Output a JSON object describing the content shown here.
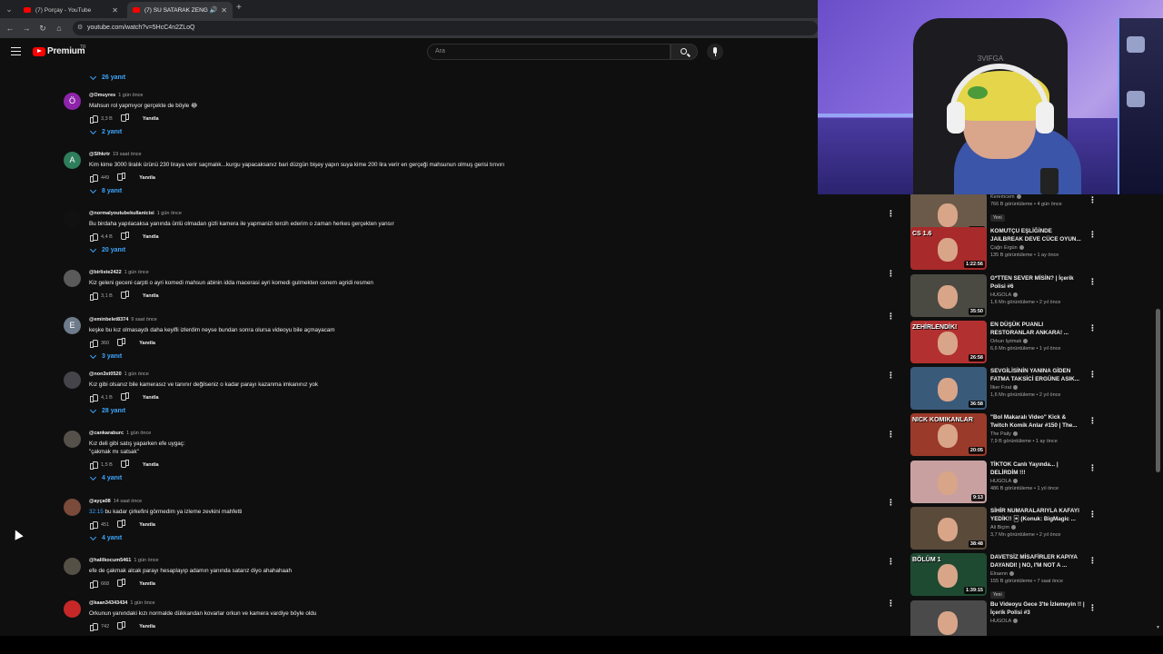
{
  "browser": {
    "tabs": [
      {
        "title": "(7) Porçay - YouTube",
        "active": false
      },
      {
        "title": "(7) SU SATARAK ZENGİN OLMAK",
        "active": true
      }
    ],
    "url": "youtube.com/watch?v=5HcC4n2ZLoQ"
  },
  "masthead": {
    "logo_text": "Premium",
    "country_code": "TR",
    "search_placeholder": "Ara"
  },
  "comments": {
    "top_replies": "26 yanıt",
    "reply_label": "Yanıtla",
    "items": [
      {
        "handle": "@Omuyres",
        "time": "1 gün önce",
        "text": "Mahsun rol yapmıyor gerçekte de böyle 😂",
        "likes": "3,3 B",
        "replies": "2 yanıt",
        "avatar_letter": "Ö",
        "avatar_color": "#8e24aa"
      },
      {
        "handle": "@Slhkrtr",
        "time": "19 saat önce",
        "text": "Kim kime 3000 liralık ürünü 230 liraya verir saçmalık...kurgu yapacaksanız bari düzgün bişey yapın suya kime 200 lira verir en gerçeği mahsunun olmuş gerisi tırıvırı",
        "likes": "449",
        "replies": "8 yanıt",
        "avatar_letter": "A",
        "avatar_color": "#2e7d5b"
      },
      {
        "handle": "@normalyoutubekullanicisi",
        "time": "1 gün önce",
        "text": "Bu birdaha yapılacaksa yanında ünlü olmadan gizli kamera ile yapmanizi tercih ederim o zaman herkes gerçekten yansır",
        "likes": "4,4 B",
        "replies": "20 yanıt",
        "avatar_letter": "",
        "avatar_color": "#111111"
      },
      {
        "handle": "@birliste2422",
        "time": "1 gün önce",
        "text": "Kiz geleni geceni carpti o ayri komedi mahsun abinin idda macerasi ayri komedi gulmekten cenem agridi resmen",
        "likes": "3,1 B",
        "replies": "",
        "avatar_letter": "",
        "avatar_color": "#5a5a5a"
      },
      {
        "handle": "@eminbelet8374",
        "time": "9 saat önce",
        "text": "keşke bu kız olmasaydı daha keyifli izlerdim neyse bundan sonra olursa videoyu bile açmayacam",
        "likes": "360",
        "replies": "3 yanıt",
        "avatar_letter": "E",
        "avatar_color": "#6d7b8a"
      },
      {
        "handle": "@non3xt0520",
        "time": "1 gün önce",
        "text": "Kız gibi olsanız bile kamerasız ve tanınır değilseniz o kadar parayı kazanma imkanınız yok",
        "likes": "4,1 B",
        "replies": "28 yanıt",
        "avatar_letter": "",
        "avatar_color": "#44444a"
      },
      {
        "handle": "@cankaraburc",
        "time": "1 gün önce",
        "text": "Kız deli gibi satış yaparken efe uygaç:\n\"çakmak mı satsak\"",
        "likes": "1,5 B",
        "replies": "4 yanıt",
        "avatar_letter": "",
        "avatar_color": "#55504a"
      },
      {
        "handle": "@ayça08",
        "time": "14 saat önce",
        "timestamp_link": "32:15",
        "text": " bu kadar çirkefini görmedim ya izleme zevkini mahfetti",
        "likes": "451",
        "replies": "4 yanıt",
        "avatar_letter": "",
        "avatar_color": "#7a4a3a"
      },
      {
        "handle": "@halilkocum5461",
        "time": "1 gün önce",
        "text": "efe de çakmak alcak parayı hesaplayıp adamın yanında satarız diyo ahahahaah",
        "likes": "668",
        "replies": "",
        "avatar_letter": "",
        "avatar_color": "#555046"
      },
      {
        "handle": "@kaan34343434",
        "time": "1 gün önce",
        "text": "Orkunun yanındaki kızı normalde dükkandan kovarlar  orkun ve kamera vardiye böyle oldu",
        "likes": "742",
        "replies": "",
        "avatar_letter": "",
        "avatar_color": "#c62828"
      }
    ]
  },
  "webcam": {
    "chair_logo": "3VIFGA"
  },
  "related": {
    "items": [
      {
        "title": "",
        "channel": "Keremcem",
        "stats": "766 B görüntüleme • 4 gün önce",
        "badge": "Yeni",
        "duration": "54:17",
        "thumb_color": "#6b5a4a"
      },
      {
        "title": "KOMUTÇU EŞLİĞİNDE JAILBREAK DEVE CÜCE OYUN...",
        "channel": "Çağrı Ergün",
        "stats": "135 B görüntüleme • 1 ay önce",
        "badge": "",
        "duration": "1:22:56",
        "thumb_color": "#a82a2a",
        "banner": "CS 1.6"
      },
      {
        "title": "G*TTEN SEVER MİSİN? | İçerik Polisi #6",
        "channel": "HUGOLA",
        "stats": "1,6 Mn görüntüleme • 2 yıl önce",
        "badge": "",
        "duration": "35:50",
        "thumb_color": "#4a4a42"
      },
      {
        "title": "EN DÜŞÜK PUANLI RESTORANLAR ANKARA! ...",
        "channel": "Orkun Işıtmak",
        "stats": "6,6 Mn görüntüleme • 1 yıl önce",
        "badge": "",
        "duration": "26:58",
        "thumb_color": "#b33030",
        "banner": "ZEHİRLENDİK!"
      },
      {
        "title": "SEVGİLİSİNİN YANINA GİDEN FATMA TAKSİCİ ERGÜNE ASIK...",
        "channel": "İlker Fırat",
        "stats": "1,6 Mn görüntüleme • 2 yıl önce",
        "badge": "",
        "duration": "36:58",
        "thumb_color": "#3a5a7a"
      },
      {
        "title": "\"Bol Makaralı Video\" Kick & Twitch Komik Anlar #150 | The...",
        "channel": "The Paily",
        "stats": "7,9 B görüntüleme • 1 ay önce",
        "badge": "",
        "duration": "20:05",
        "thumb_color": "#9a3a2a",
        "banner": "NICK KOMIKANLAR"
      },
      {
        "title": "TİKTOK Canlı Yayında... | DELİRDİM !!!",
        "channel": "HUGOLA",
        "stats": "486 B görüntüleme • 1 yıl önce",
        "badge": "",
        "duration": "9:13",
        "thumb_color": "#c8a0a0"
      },
      {
        "title": "SİHİR NUMARALARIYLA KAFAYI YEDİK!! 🃏 (Konuk: BigMagic ...",
        "channel": "Ali Biçim",
        "stats": "3,7 Mn görüntüleme • 2 yıl önce",
        "badge": "",
        "duration": "38:48",
        "thumb_color": "#5a4a3a"
      },
      {
        "title": "DAVETSİZ MİSAFİRLER KAPIYA DAYANDI! | NO, I'M NOT A ...",
        "channel": "Elraenn",
        "stats": "155 B görüntüleme • 7 saat önce",
        "badge": "Yeni",
        "duration": "1:39:15",
        "thumb_color": "#1f4a32",
        "banner": "BÖLÜM 1"
      },
      {
        "title": "Bu Videoyu Gece 3'te İzlemeyin !! | İçerik Polisi #3",
        "channel": "HUGOLA",
        "stats": "",
        "badge": "",
        "duration": "",
        "thumb_color": "#4a4a4a"
      }
    ]
  }
}
